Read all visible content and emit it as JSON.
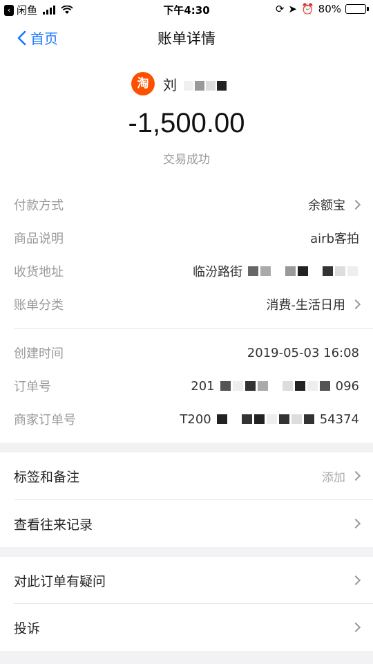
{
  "status_bar": {
    "app_name": "闲鱼",
    "time": "下午4:30",
    "battery": "80%",
    "battery_level": 0.8
  },
  "nav": {
    "back_label": "首页",
    "title": "账单详情"
  },
  "header": {
    "merchant_badge": "淘",
    "merchant_name": "刘",
    "amount": "-1,500.00",
    "status": "交易成功"
  },
  "details": {
    "payment_method": {
      "label": "付款方式",
      "value": "余额宝"
    },
    "product_desc": {
      "label": "商品说明",
      "value": "airb客拍"
    },
    "address": {
      "label": "收货地址",
      "value": "临汾路街"
    },
    "category": {
      "label": "账单分类",
      "value": "消费-生活日用"
    },
    "created_time": {
      "label": "创建时间",
      "value": "2019-05-03 16:08"
    },
    "order_no": {
      "label": "订单号",
      "value_prefix": "201",
      "value_suffix": "096"
    },
    "merchant_order_no": {
      "label": "商家订单号",
      "value_prefix": "T200",
      "value_suffix": "54374"
    }
  },
  "section1": {
    "tags_notes": {
      "label": "标签和备注",
      "action": "添加"
    },
    "history": {
      "label": "查看往来记录"
    }
  },
  "section2": {
    "question": {
      "label": "对此订单有疑问"
    },
    "complaint": {
      "label": "投诉"
    }
  },
  "colors": {
    "accent": "#1677ff",
    "taobao": "#ff5000"
  }
}
